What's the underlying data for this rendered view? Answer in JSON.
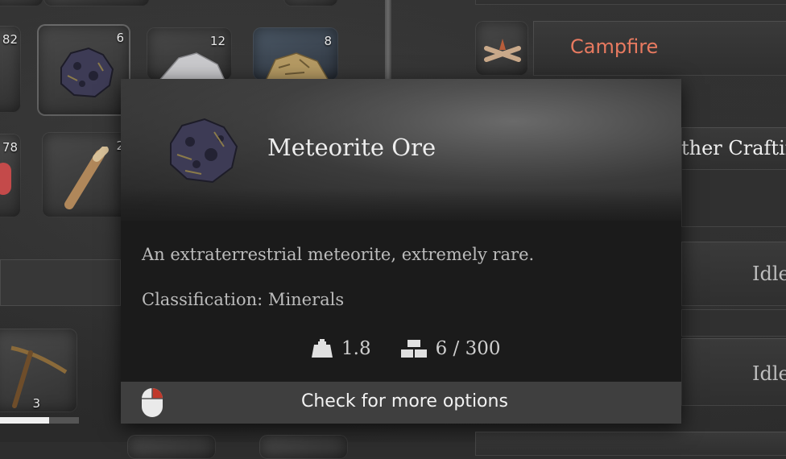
{
  "inventory": {
    "slots": [
      {
        "count": "82",
        "icon": "unknown-item-icon"
      },
      {
        "count": "6",
        "icon": "meteorite-ore-icon"
      },
      {
        "count": "12",
        "icon": "silver-ore-icon"
      },
      {
        "count": "8",
        "icon": "sandstone-icon"
      },
      {
        "count": "78",
        "icon": "raw-meat-icon"
      },
      {
        "count": "2",
        "icon": "wooden-club-icon"
      },
      {
        "count": "3",
        "icon": "pickaxe-icon"
      }
    ],
    "durability": 0.62
  },
  "crafting": {
    "campfire_label": "Campfire",
    "other_crafting_label": "ther Craftin",
    "idle_1": "Idle",
    "idle_2": "Idle"
  },
  "tooltip": {
    "title": "Meteorite Ore",
    "description": "An extraterrestrial meteorite, extremely rare.",
    "classification": "Classification: Minerals",
    "weight": "1.8",
    "stack": "6 / 300",
    "footer": "Check for more options"
  },
  "colors": {
    "accent": "#e87a60",
    "ore": "#3d3b55"
  }
}
